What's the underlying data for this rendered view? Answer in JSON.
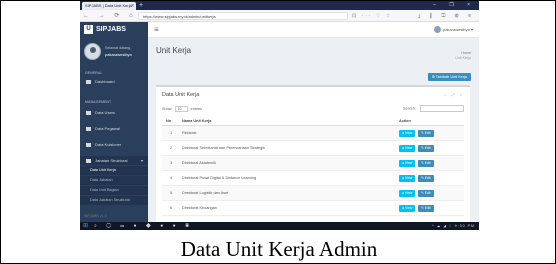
{
  "browser": {
    "tab_title": "SIPJABS | Data Unit Kerja",
    "tab_close": "×",
    "new_tab": "+",
    "window_controls": "– ❐ ×",
    "nav_icons": "← → ⟳ ⌂",
    "url": "https://www.sipjabs.my.id/admin/unitkerja",
    "url_actions": "⊡ ··· ♡ ☆",
    "toolbar_icons": "⤓ ⫼ ◫ ⚙ ≡"
  },
  "app": {
    "logo_letter": "U",
    "logo_text": "SIPJABS",
    "menu_icon": "≡",
    "user_name": "pakarawestbyo ▾"
  },
  "sidebar": {
    "welcome": "Selamat datang,",
    "username": "pakarawestbyo",
    "section_general": "GENERAL",
    "section_management": "MANAGEMENT",
    "items": [
      {
        "label": "Dashboard"
      },
      {
        "label": "Data Users"
      },
      {
        "label": "Data Pegawai"
      },
      {
        "label": "Data Kuisioner"
      },
      {
        "label": "Jabatan Struktural"
      }
    ],
    "submenu": [
      {
        "label": "Data Unit Kerja"
      },
      {
        "label": "Data Jabatan"
      },
      {
        "label": "Data Unit Bagian"
      },
      {
        "label": "Data Jabatan Struktural"
      }
    ],
    "caret": "▾",
    "footer": "SIPJABS v1.0"
  },
  "page": {
    "title": "Unit Kerja",
    "breadcrumb_home": "Home",
    "breadcrumb_current": "Unit Kerja",
    "add_button": "⊕ Tambah Unit Kerja"
  },
  "table": {
    "box_title": "Data Unit Kerja",
    "box_tools": "– ⤢ ×",
    "show_label": "Show",
    "show_value": "10",
    "entries_label": "entries",
    "search_label": "Search:",
    "headers": {
      "no": "No",
      "name": "Nama Unit Kerja",
      "action": "Action"
    },
    "rows": [
      {
        "no": "1",
        "name": "Rektorat"
      },
      {
        "no": "2",
        "name": "Direktorat Sekretariat dan Perencanaan Strategis"
      },
      {
        "no": "3",
        "name": "Direktorat Akademik"
      },
      {
        "no": "4",
        "name": "Direktorat Pusat Digital & Distance Learning"
      },
      {
        "no": "5",
        "name": "Direktorat Logistik dan Aset"
      },
      {
        "no": "6",
        "name": "Direktorat Keuangan"
      }
    ],
    "view_label": "● View",
    "edit_label": "✎ Edit"
  },
  "taskbar": {
    "start": "⊞",
    "apps": "⌕ ◯ ▭ ● ◆ ● ● ◉",
    "tray": "^ ☁ ◢ ⎍ 9:30 PM"
  },
  "caption": "Data Unit Kerja Admin"
}
